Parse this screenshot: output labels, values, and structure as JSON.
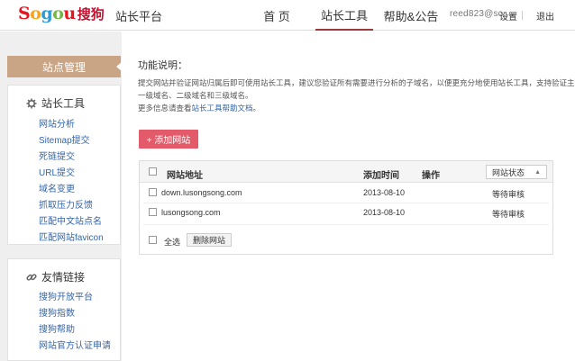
{
  "header": {
    "logo_letters": [
      "S",
      "o",
      "g",
      "o",
      "u"
    ],
    "logo_colors": [
      "#e8141e",
      "#f7a31c",
      "#2b9ad8",
      "#72b744",
      "#e8141e"
    ],
    "logo_cn": "搜狗",
    "subtitle": "站长平台",
    "nav": {
      "home": "首 页",
      "tools": "站长工具",
      "help": "帮助&公告"
    },
    "email": "reed823@so...",
    "settings": "设置",
    "logout": "退出"
  },
  "sidebar": {
    "active": "站点管理",
    "tools_title": "站长工具",
    "tools_items": [
      "网站分析",
      "Sitemap提交",
      "死链提交",
      "URL提交",
      "域名变更",
      "抓取压力反馈",
      "匹配中文站点名",
      "匹配网站favicon"
    ],
    "links_title": "友情链接",
    "links_items": [
      "搜狗开放平台",
      "搜狗指数",
      "搜狗帮助",
      "网站官方认证申请"
    ]
  },
  "main": {
    "title": "功能说明：",
    "desc_line1": "提交网站并验证网站归属后即可使用站长工具，建议您验证所有需要进行分析的子域名，以便更充分地使用站长工具，支持验证主域名、",
    "desc_line2": "一级域名、二级域名和三级域名。",
    "desc_line3_prefix": "更多信息请查看",
    "desc_line3_link": "站长工具帮助文档",
    "desc_line3_suffix": "。",
    "add_button": "+ 添加网站"
  },
  "table": {
    "headers": {
      "site": "网站地址",
      "time": "添加时间",
      "action": "操作",
      "status": "网站状态"
    },
    "rows": [
      {
        "site": "down.lusongsong.com",
        "time": "2013-08-10",
        "status": "等待审核"
      },
      {
        "site": "lusongsong.com",
        "time": "2013-08-10",
        "status": "等待审核"
      }
    ],
    "select_all": "全选",
    "delete_button": "删除网站"
  }
}
